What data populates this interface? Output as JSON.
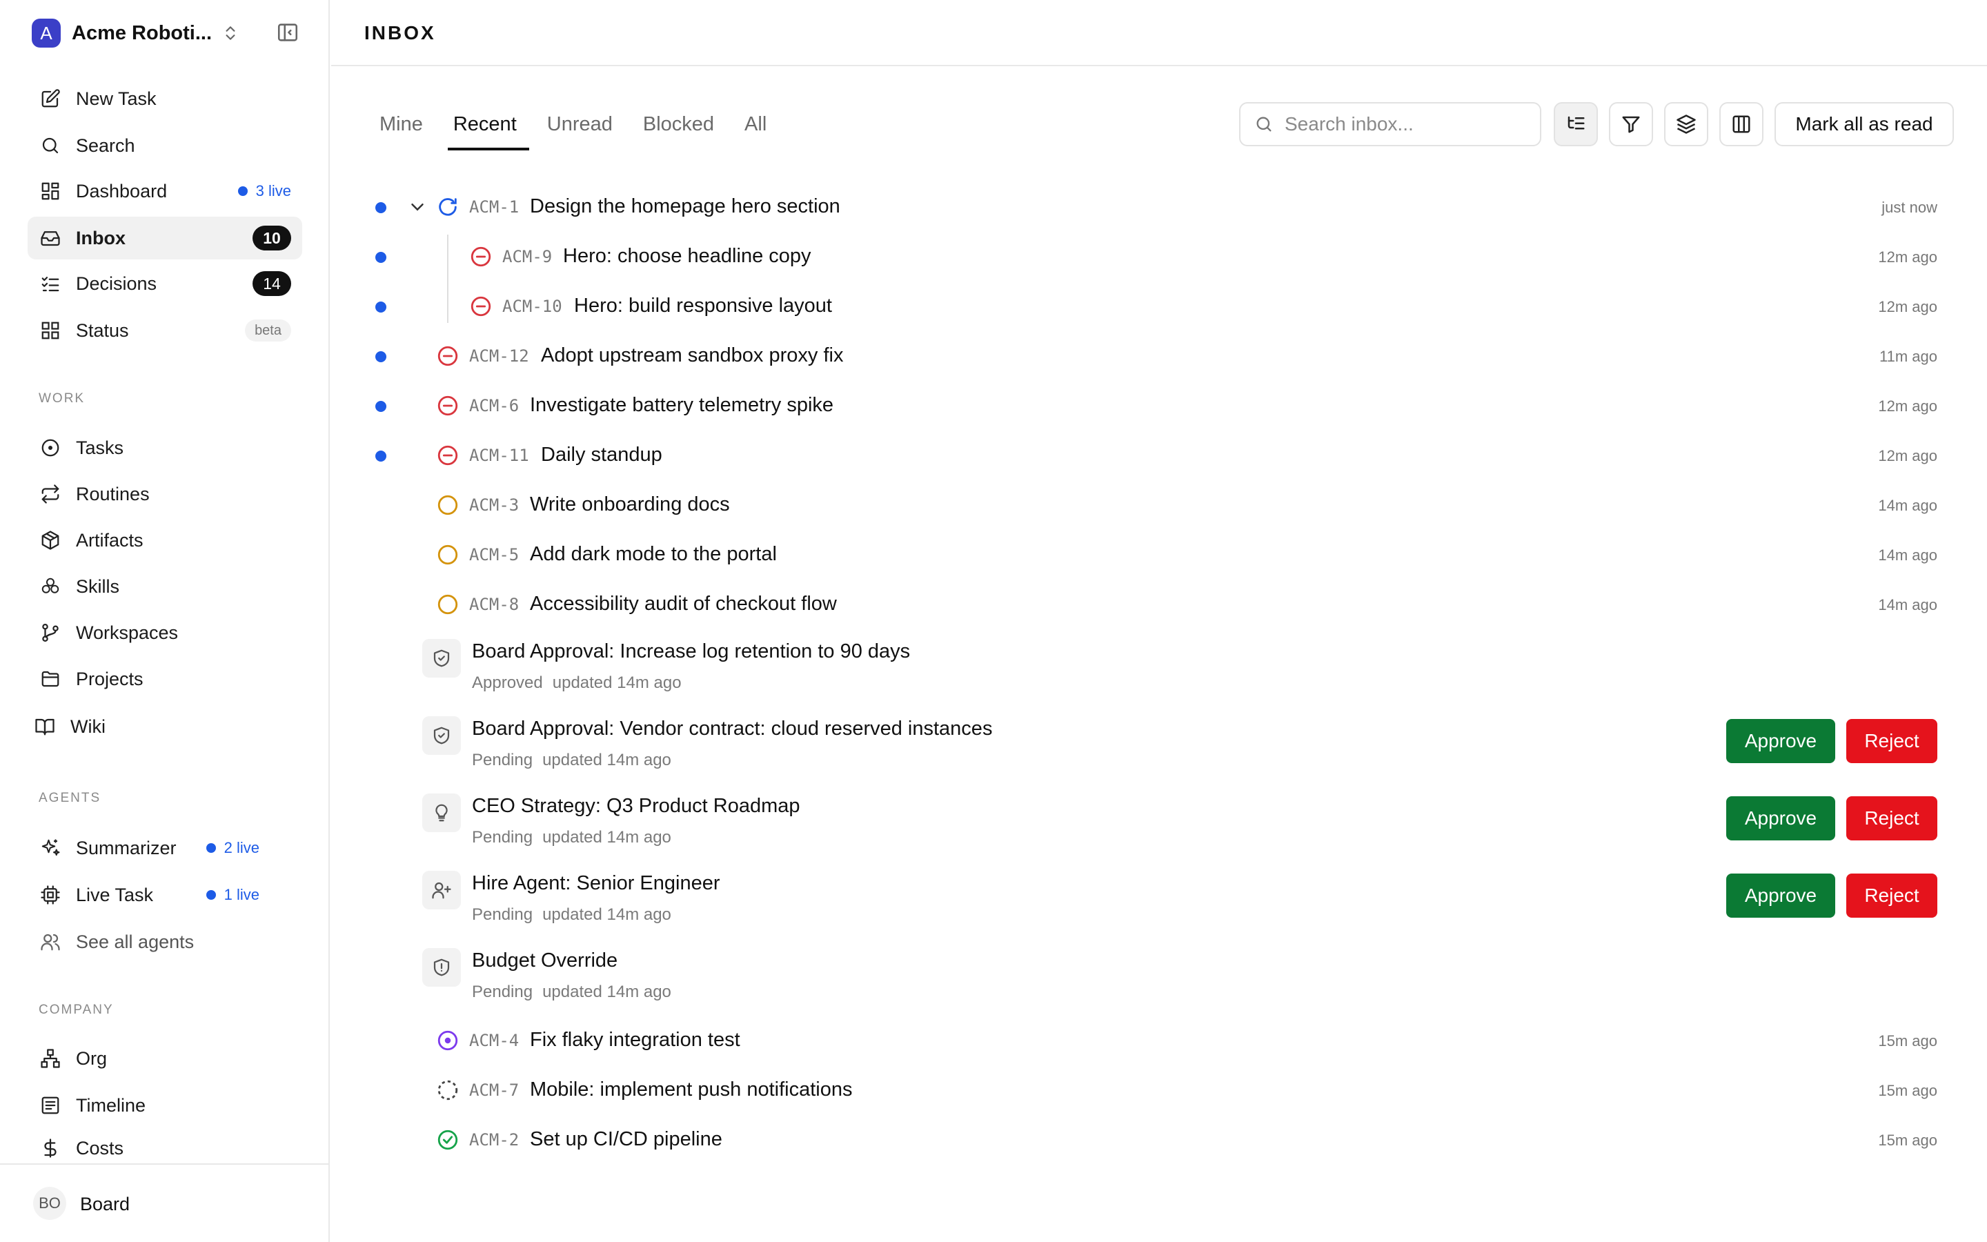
{
  "org": {
    "initial": "A",
    "name": "Acme Roboti..."
  },
  "nav_main": [
    {
      "label": "New Task"
    },
    {
      "label": "Search"
    },
    {
      "label": "Dashboard",
      "live": "3 live"
    },
    {
      "label": "Inbox",
      "count": "10"
    },
    {
      "label": "Decisions",
      "count": "14"
    },
    {
      "label": "Status",
      "badge": "beta"
    }
  ],
  "sections": {
    "work": "WORK",
    "agents": "AGENTS",
    "company": "COMPANY"
  },
  "nav_work": [
    {
      "label": "Tasks"
    },
    {
      "label": "Routines"
    },
    {
      "label": "Artifacts"
    },
    {
      "label": "Skills"
    },
    {
      "label": "Workspaces"
    },
    {
      "label": "Projects"
    },
    {
      "label": "Wiki"
    }
  ],
  "nav_agents": [
    {
      "label": "Summarizer",
      "live": "2 live"
    },
    {
      "label": "Live Task",
      "live": "1 live"
    },
    {
      "label": "See all agents"
    }
  ],
  "nav_company": [
    {
      "label": "Org"
    },
    {
      "label": "Timeline"
    },
    {
      "label": "Costs"
    }
  ],
  "footer": {
    "initials": "BO",
    "name": "Board"
  },
  "page": {
    "title": "INBOX"
  },
  "tabs": [
    {
      "label": "Mine"
    },
    {
      "label": "Recent"
    },
    {
      "label": "Unread"
    },
    {
      "label": "Blocked"
    },
    {
      "label": "All"
    }
  ],
  "search": {
    "placeholder": "Search inbox..."
  },
  "toolbar": {
    "mark_all_read": "Mark all as read"
  },
  "actions": {
    "approve": "Approve",
    "reject": "Reject"
  },
  "tasks": [
    {
      "id": "ACM-1",
      "title": "Design the homepage hero section",
      "time": "just now",
      "status": "in-progress",
      "unread": true
    },
    {
      "id": "ACM-9",
      "title": "Hero: choose headline copy",
      "time": "12m ago",
      "status": "blocked",
      "unread": true
    },
    {
      "id": "ACM-10",
      "title": "Hero: build responsive layout",
      "time": "12m ago",
      "status": "blocked",
      "unread": true
    },
    {
      "id": "ACM-12",
      "title": "Adopt upstream sandbox proxy fix",
      "time": "11m ago",
      "status": "blocked",
      "unread": true
    },
    {
      "id": "ACM-6",
      "title": "Investigate battery telemetry spike",
      "time": "12m ago",
      "status": "blocked",
      "unread": true
    },
    {
      "id": "ACM-11",
      "title": "Daily standup",
      "time": "12m ago",
      "status": "blocked",
      "unread": true
    },
    {
      "id": "ACM-3",
      "title": "Write onboarding docs",
      "time": "14m ago",
      "status": "todo",
      "unread": false
    },
    {
      "id": "ACM-5",
      "title": "Add dark mode to the portal",
      "time": "14m ago",
      "status": "todo",
      "unread": false
    },
    {
      "id": "ACM-8",
      "title": "Accessibility audit of checkout flow",
      "time": "14m ago",
      "status": "todo",
      "unread": false
    },
    {
      "id": "ACM-4",
      "title": "Fix flaky integration test",
      "time": "15m ago",
      "status": "in-review",
      "unread": false
    },
    {
      "id": "ACM-7",
      "title": "Mobile: implement push notifications",
      "time": "15m ago",
      "status": "backlog",
      "unread": false
    },
    {
      "id": "ACM-2",
      "title": "Set up CI/CD pipeline",
      "time": "15m ago",
      "status": "done",
      "unread": false
    }
  ],
  "approvals": [
    {
      "title": "Board Approval: Increase log retention to 90 days",
      "state": "Approved",
      "updated": "updated 14m ago",
      "icon": "shield-check-icon"
    },
    {
      "title": "Board Approval: Vendor contract: cloud reserved instances",
      "state": "Pending",
      "updated": "updated 14m ago",
      "icon": "shield-check-icon"
    },
    {
      "title": "CEO Strategy: Q3 Product Roadmap",
      "state": "Pending",
      "updated": "updated 14m ago",
      "icon": "lightbulb-icon"
    },
    {
      "title": "Hire Agent: Senior Engineer",
      "state": "Pending",
      "updated": "updated 14m ago",
      "icon": "user-plus-icon"
    },
    {
      "title": "Budget Override",
      "state": "Pending",
      "updated": "updated 14m ago",
      "icon": "shield-alert-icon"
    }
  ],
  "colors": {
    "accent_blue": "#1d5be6",
    "approve_green": "#0b7a34",
    "reject_red": "#e5131c",
    "blocked_red": "#d9363e",
    "todo_amber": "#d4930c",
    "review_purple": "#7c3aed",
    "done_green": "#16a34a"
  }
}
